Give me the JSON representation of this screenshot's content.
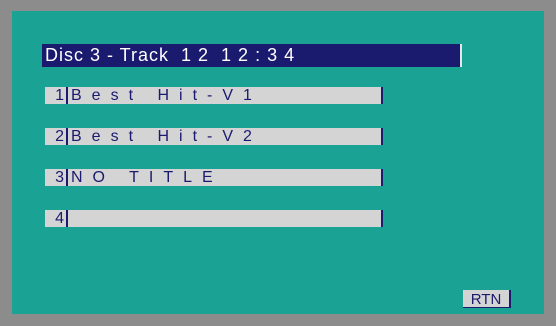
{
  "header": {
    "disc_track_time": "Disc 3 - Track  1 2  1 2 : 3 4"
  },
  "tracks": [
    {
      "number": "1",
      "title": "Best Hit-V1"
    },
    {
      "number": "2",
      "title": "Best Hit-V2"
    },
    {
      "number": "3",
      "title": "NO TITLE"
    },
    {
      "number": "4",
      "title": ""
    }
  ],
  "buttons": {
    "return_label": "RTN"
  },
  "colors": {
    "bezel": "#8c8c8c",
    "screen_background": "#1aa394",
    "header_background": "#1a1a6e",
    "row_background": "#d4d4d4",
    "text_dark": "#1a1a6e"
  }
}
